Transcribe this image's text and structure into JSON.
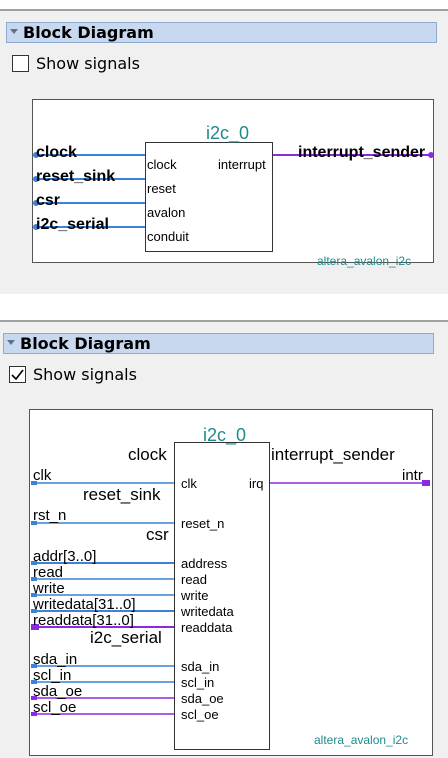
{
  "panels": [
    {
      "header": "Block Diagram",
      "checkbox": {
        "label": "Show signals",
        "checked": false
      },
      "diagram": {
        "instance": "i2c_0",
        "component": "altera_avalon_i2c",
        "inputs": [
          {
            "external": "clock",
            "port": "clock"
          },
          {
            "external": "reset_sink",
            "port": "reset"
          },
          {
            "external": "csr",
            "port": "avalon"
          },
          {
            "external": "i2c_serial",
            "port": "conduit"
          }
        ],
        "outputs": [
          {
            "external": "interrupt_sender",
            "port": "interrupt"
          }
        ]
      }
    },
    {
      "header": "Block Diagram",
      "checkbox": {
        "label": "Show signals",
        "checked": true
      },
      "diagram": {
        "instance": "i2c_0",
        "component": "altera_avalon_i2c",
        "groups_left": [
          "clock",
          "reset_sink",
          "csr",
          "i2c_serial"
        ],
        "group_right": "interrupt_sender",
        "signals_left": [
          {
            "external": "clk",
            "port": "clk"
          },
          {
            "external": "rst_n",
            "port": "reset_n"
          },
          {
            "external": "addr[3..0]",
            "port": "address"
          },
          {
            "external": "read",
            "port": "read"
          },
          {
            "external": "write",
            "port": "write"
          },
          {
            "external": "writedata[31..0]",
            "port": "writedata"
          },
          {
            "external": "readdata[31..0]",
            "port": "readdata"
          },
          {
            "external": "sda_in",
            "port": "sda_in"
          },
          {
            "external": "scl_in",
            "port": "scl_in"
          },
          {
            "external": "sda_oe",
            "port": "sda_oe"
          },
          {
            "external": "scl_oe",
            "port": "scl_oe"
          }
        ],
        "signal_right": {
          "external": "intr",
          "port": "irq"
        }
      }
    }
  ],
  "colors": {
    "input_wire": "#3c82d6",
    "output_wire": "#8a2be2",
    "instance_text": "#1f8b8b",
    "header_bg": "#c8d8ee"
  }
}
